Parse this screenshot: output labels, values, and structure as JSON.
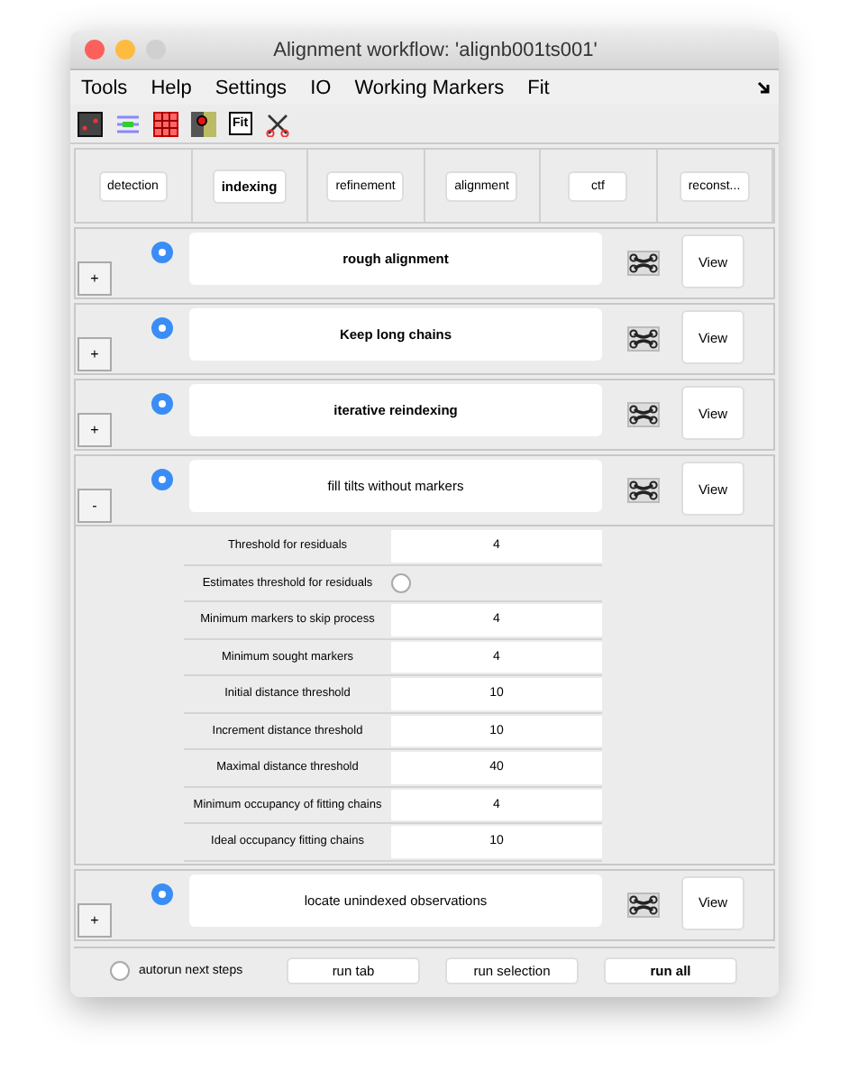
{
  "window": {
    "title": "Alignment workflow: 'alignb001ts001'"
  },
  "menu": [
    "Tools",
    "Help",
    "Settings",
    "IO",
    "Working Markers",
    "Fit"
  ],
  "toolbar": {
    "fit_label": "Fit"
  },
  "tabs": [
    {
      "label": "detection",
      "selected": false
    },
    {
      "label": "indexing",
      "selected": true
    },
    {
      "label": "refinement",
      "selected": false
    },
    {
      "label": "alignment",
      "selected": false
    },
    {
      "label": "ctf",
      "selected": false
    },
    {
      "label": "reconst...",
      "selected": false
    }
  ],
  "steps": [
    {
      "name": "rough alignment",
      "bold": true,
      "selected": true,
      "toggle": "+",
      "expanded": false,
      "view": "View"
    },
    {
      "name": "Keep long chains",
      "bold": true,
      "selected": true,
      "toggle": "+",
      "expanded": false,
      "view": "View"
    },
    {
      "name": "iterative reindexing",
      "bold": true,
      "selected": true,
      "toggle": "+",
      "expanded": false,
      "view": "View"
    },
    {
      "name": "fill tilts without markers",
      "bold": false,
      "selected": true,
      "toggle": "-",
      "expanded": true,
      "view": "View",
      "params": [
        {
          "kind": "field",
          "label": "Threshold for residuals",
          "value": "4"
        },
        {
          "kind": "radio",
          "label": "Estimates threshold for residuals",
          "checked": false
        },
        {
          "kind": "field",
          "label": "Minimum markers to skip process",
          "value": "4"
        },
        {
          "kind": "field",
          "label": "Minimum sought markers",
          "value": "4"
        },
        {
          "kind": "field",
          "label": "Initial distance threshold",
          "value": "10"
        },
        {
          "kind": "field",
          "label": "Increment distance threshold",
          "value": "10"
        },
        {
          "kind": "field",
          "label": "Maximal distance threshold",
          "value": "40"
        },
        {
          "kind": "field",
          "label": "Minimum occupancy of fitting chains",
          "value": "4"
        },
        {
          "kind": "field",
          "label": "Ideal occupancy fitting chains",
          "value": "10"
        }
      ]
    },
    {
      "name": "locate unindexed observations",
      "bold": false,
      "selected": true,
      "toggle": "+",
      "expanded": false,
      "view": "View"
    }
  ],
  "footer": {
    "autorun": {
      "label": "autorun next steps",
      "checked": false
    },
    "buttons": [
      {
        "label": "run tab",
        "bold": false
      },
      {
        "label": "run selection",
        "bold": false
      },
      {
        "label": "run all",
        "bold": true
      }
    ]
  }
}
